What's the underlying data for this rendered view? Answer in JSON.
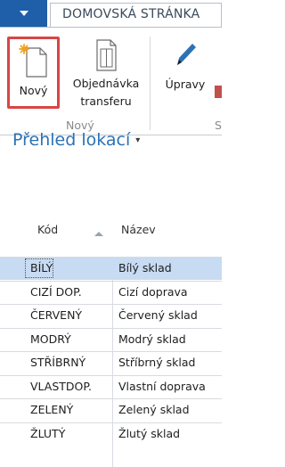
{
  "ribbon": {
    "active_tab": "DOMOVSKÁ STRÁNKA",
    "buttons": {
      "new": "Nový",
      "transfer_order_line1": "Objednávka",
      "transfer_order_line2": "transferu",
      "edit": "Úpravy"
    },
    "group_new_label": "Nový",
    "group_cut_label": "S",
    "icons": {
      "file": "file-menu-icon",
      "new": "new-document-icon",
      "transfer_order": "transfer-order-icon",
      "edit": "pencil-icon"
    }
  },
  "page": {
    "title": "Přehled lokací",
    "title_caret": "▾"
  },
  "table": {
    "columns": [
      "Kód",
      "Název"
    ],
    "sort_column": "Kód",
    "rows": [
      {
        "code": "BÍLÝ",
        "name": "Bílý sklad"
      },
      {
        "code": "CIZÍ DOP.",
        "name": "Cizí doprava"
      },
      {
        "code": "ČERVENÝ",
        "name": "Červený sklad"
      },
      {
        "code": "MODRÝ",
        "name": "Modrý sklad"
      },
      {
        "code": "STŘÍBRNÝ",
        "name": "Stříbrný sklad"
      },
      {
        "code": "VLASTDOP.",
        "name": "Vlastní doprava"
      },
      {
        "code": "ZELENÝ",
        "name": "Zelený sklad"
      },
      {
        "code": "ŽLUTÝ",
        "name": "Žlutý sklad"
      }
    ],
    "selected_row": 0
  },
  "colors": {
    "file_button": "#1f5ea8",
    "title": "#2c72b5",
    "highlight_border": "#d94545",
    "selected_row": "#c7dbf2"
  }
}
